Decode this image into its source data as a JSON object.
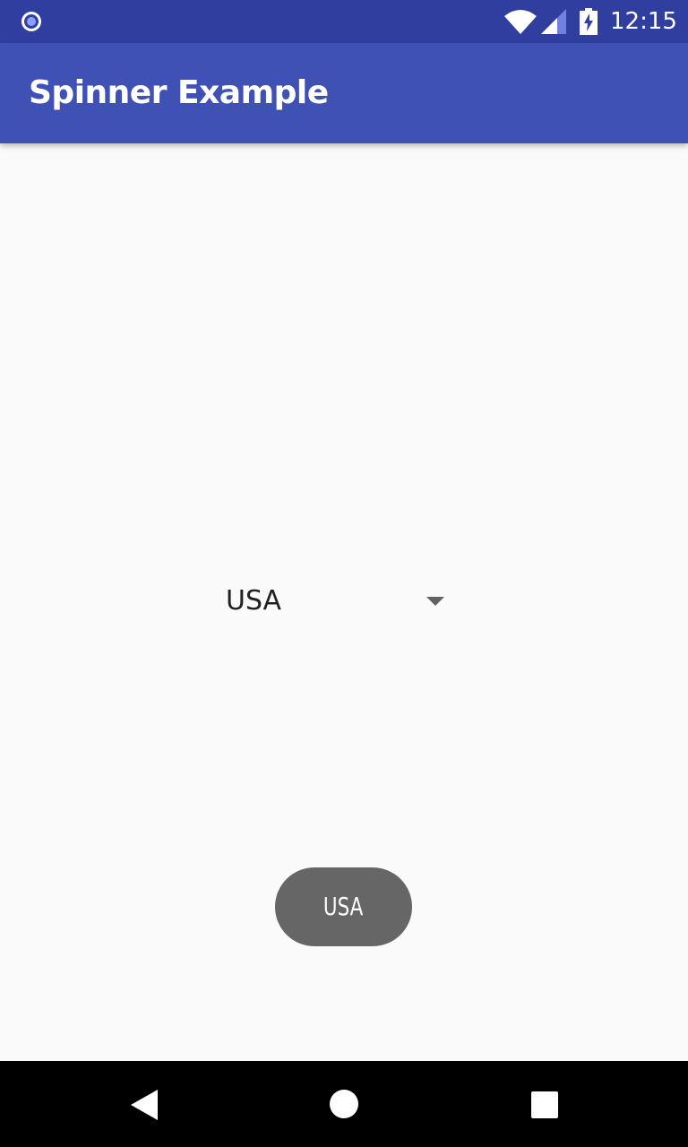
{
  "status_bar": {
    "time": "12:15",
    "icons": [
      "notification-dot-icon",
      "wifi-icon",
      "cell-signal-icon",
      "battery-charging-icon"
    ]
  },
  "app_bar": {
    "title": "Spinner Example"
  },
  "spinner": {
    "selected_value": "USA",
    "icon": "dropdown-arrow-icon"
  },
  "toast": {
    "text": "USA"
  },
  "nav_bar": {
    "icons": [
      "back-icon",
      "home-icon",
      "recents-icon"
    ]
  },
  "colors": {
    "status_bar": "#303f9f",
    "app_bar": "#3f51b5",
    "background": "#fafafa",
    "toast": "#666666",
    "nav_bar": "#000000"
  }
}
